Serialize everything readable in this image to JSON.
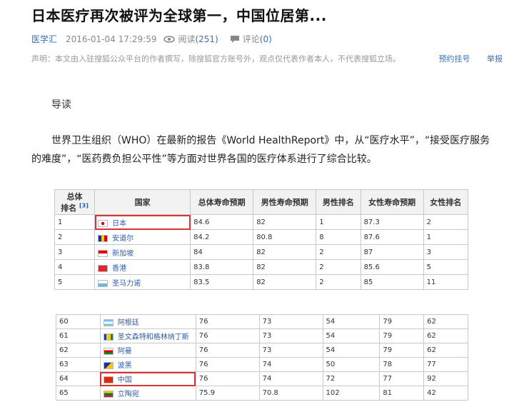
{
  "article": {
    "title": "日本医疗再次被评为全球第一，中国位居第...",
    "source": "医学汇",
    "date": "2016-01-04 17:29:59",
    "reads_label": "阅读",
    "reads_count": "(251)",
    "comments_label": "评论",
    "comments_count": "(0)",
    "notice": "声明：本文由入驻搜狐公众平台的作者撰写，除搜狐官方账号外，观点仅代表作者本人，不代表搜狐立场。",
    "subscribe": "预约挂号",
    "report": "举报",
    "lead": "导读",
    "paragraph": "世界卫生组织（WHO）在最新的报告《World HealthReport》中，从“医疗水平”，“接受医疗服务的难度”，“医药费负担公平性”等方面对世界各国的医疗体系进行了综合比较。"
  },
  "table": {
    "headers": {
      "rank_line1": "总体",
      "rank_line2": "排名",
      "rank_ref": "[3]",
      "country": "国家",
      "life": "总体寿命预期",
      "male_life": "男性寿命预期",
      "male_rank": "男性排名",
      "female_life": "女性寿命预期",
      "female_rank": "女性排名"
    },
    "top_rows": [
      {
        "rank": "1",
        "country": "日本",
        "life": "84.6",
        "male_life": "82",
        "male_rank": "1",
        "female_life": "87.3",
        "female_rank": "2"
      },
      {
        "rank": "2",
        "country": "安道尔",
        "life": "84.2",
        "male_life": "80.8",
        "male_rank": "8",
        "female_life": "87.6",
        "female_rank": "1"
      },
      {
        "rank": "3",
        "country": "新加坡",
        "life": "84",
        "male_life": "82",
        "male_rank": "2",
        "female_life": "87",
        "female_rank": "3"
      },
      {
        "rank": "4",
        "country": "香港",
        "life": "83.8",
        "male_life": "82",
        "male_rank": "2",
        "female_life": "85.6",
        "female_rank": "5"
      },
      {
        "rank": "5",
        "country": "圣马力诺",
        "life": "83.5",
        "male_life": "82",
        "male_rank": "2",
        "female_life": "85",
        "female_rank": "11"
      }
    ],
    "mid_rows": [
      {
        "rank": "60",
        "country": "阿根廷",
        "life": "76",
        "male_life": "73",
        "male_rank": "54",
        "female_life": "79",
        "female_rank": "62"
      },
      {
        "rank": "61",
        "country": "圣文森特和格林纳丁斯",
        "life": "76",
        "male_life": "73",
        "male_rank": "54",
        "female_life": "79",
        "female_rank": "62"
      },
      {
        "rank": "62",
        "country": "阿曼",
        "life": "76",
        "male_life": "73",
        "male_rank": "54",
        "female_life": "79",
        "female_rank": "62"
      },
      {
        "rank": "63",
        "country": "波黑",
        "life": "76",
        "male_life": "74",
        "male_rank": "50",
        "female_life": "78",
        "female_rank": "77"
      },
      {
        "rank": "64",
        "country": "中国",
        "life": "76",
        "male_life": "74",
        "male_rank": "72",
        "female_life": "77",
        "female_rank": "92"
      },
      {
        "rank": "65",
        "country": "立陶宛",
        "life": "75.9",
        "male_life": "70.8",
        "male_rank": "102",
        "female_life": "81",
        "female_rank": "42"
      }
    ]
  }
}
